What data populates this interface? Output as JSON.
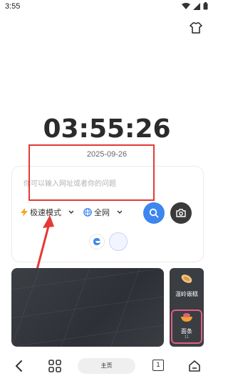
{
  "status": {
    "time": "3:55"
  },
  "clock": {
    "time": "03:55:26",
    "date": "2025-09-26"
  },
  "search": {
    "placeholder": "你可以输入网址或者你的问题",
    "mode_label": "极速模式",
    "network_label": "全网"
  },
  "feed": {
    "items": [
      {
        "label": "温岭嵌糕"
      },
      {
        "label": "面条",
        "sub": "11"
      }
    ]
  },
  "nav": {
    "home_label": "主页",
    "tab_count": "1"
  },
  "colors": {
    "accent": "#3d86f0",
    "annotation": "#e53935",
    "highlight": "#e0607e"
  }
}
